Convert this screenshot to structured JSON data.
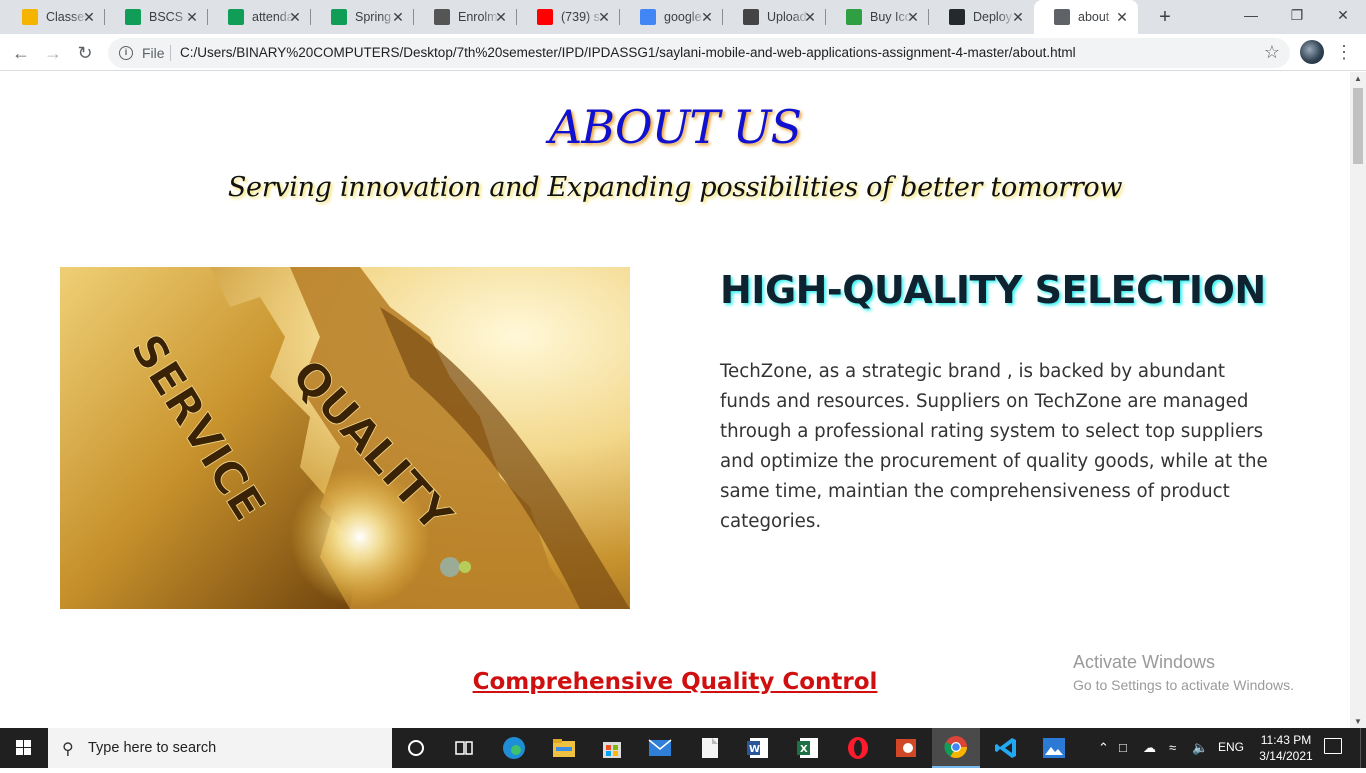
{
  "browser": {
    "tabs": [
      {
        "label": "Classes",
        "icon": "google-classroom-icon",
        "color": "#f4b400"
      },
      {
        "label": "BSCS -",
        "icon": "sheets-icon",
        "color": "#0f9d58"
      },
      {
        "label": "attenda",
        "icon": "sheets-icon",
        "color": "#0f9d58"
      },
      {
        "label": "Spring",
        "icon": "sheets-icon",
        "color": "#0f9d58"
      },
      {
        "label": "Enrolm",
        "icon": "enrolment-icon",
        "color": "#555555"
      },
      {
        "label": "(739) s",
        "icon": "youtube-icon",
        "color": "#ff0000"
      },
      {
        "label": "google",
        "icon": "google-icon",
        "color": "#4285f4"
      },
      {
        "label": "Upload",
        "icon": "graduation-cap-icon",
        "color": "#444444"
      },
      {
        "label": "Buy Ico",
        "icon": "iconfinder-icon",
        "color": "#2ea043"
      },
      {
        "label": "Deploy",
        "icon": "github-icon",
        "color": "#24292e"
      },
      {
        "label": "about",
        "icon": "globe-icon",
        "color": "#5f6368"
      }
    ],
    "active_tab_index": 10,
    "address": {
      "file_label": "File",
      "url": "C:/Users/BINARY%20COMPUTERS/Desktop/7th%20semester/IPD/IPDASSG1/saylani-mobile-and-web-applications-assignment-4-master/about.html"
    }
  },
  "page": {
    "title": "ABOUT US",
    "subtitle": "Serving innovation and Expanding possibilities of better tomorrow",
    "image_text_1": "SERVICE",
    "image_text_2": "QUALITY",
    "section_heading": "HIGH-QUALITY SELECTION",
    "section_text": "TechZone, as a strategic brand , is backed by abundant funds and resources. Suppliers on TechZone are managed through a professional rating system to select top suppliers and optimize the procurement of quality goods, while at the same time, maintian the comprehensiveness of product categories.",
    "link_heading": "Comprehensive Quality Control"
  },
  "watermark": {
    "line1": "Activate Windows",
    "line2": "Go to Settings to activate Windows."
  },
  "taskbar": {
    "search_placeholder": "Type here to search",
    "language": "ENG",
    "time": "11:43 PM",
    "date": "3/14/2021"
  }
}
